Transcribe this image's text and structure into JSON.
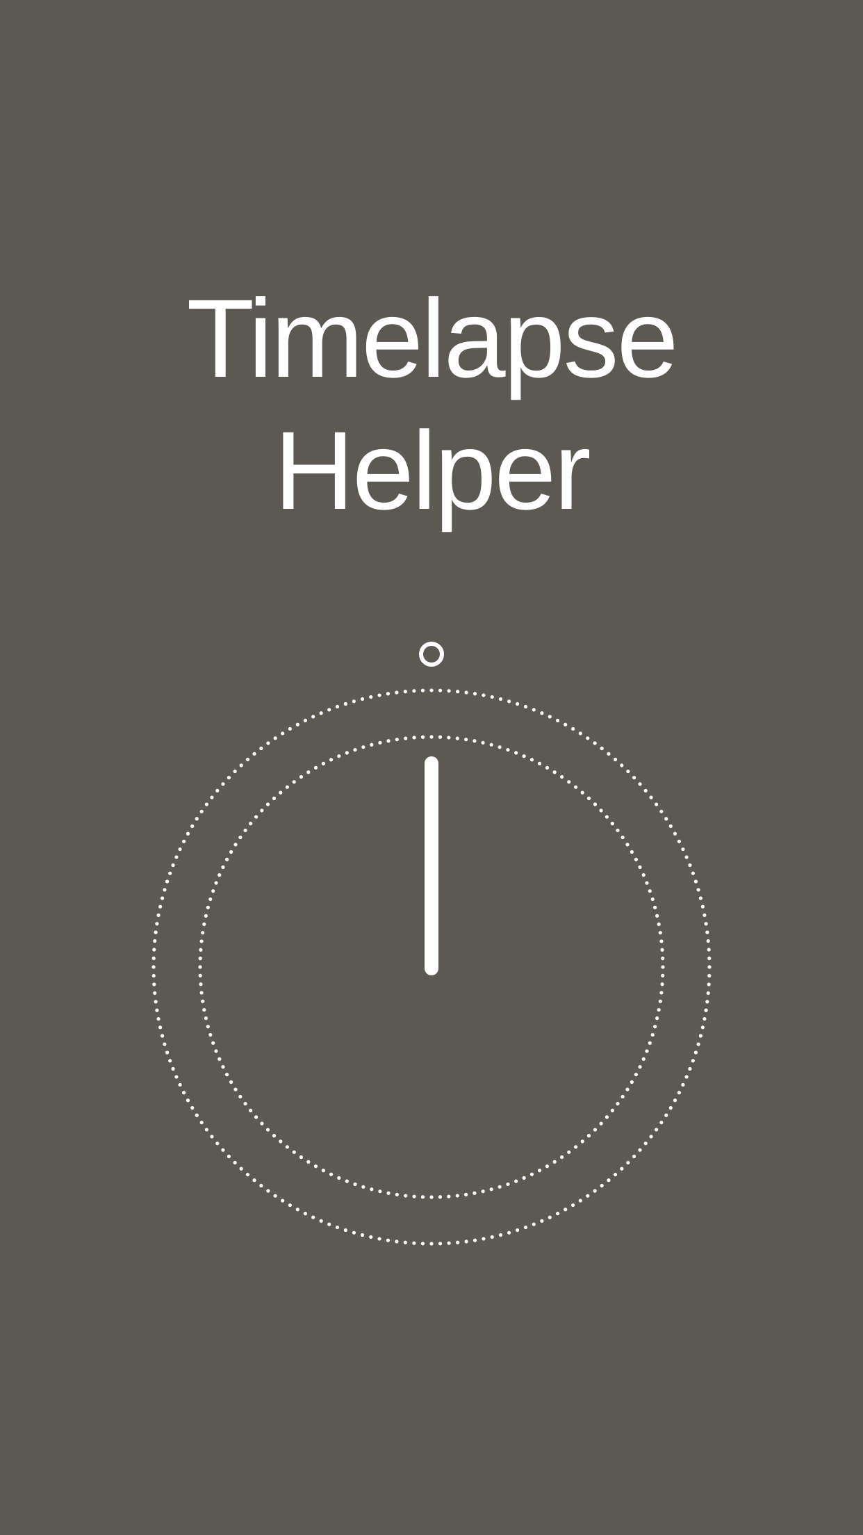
{
  "app": {
    "title_line1": "Timelapse",
    "title_line2": "Helper"
  },
  "dial": {
    "icons": {
      "outer_ring": "dotted-circle",
      "inner_ring": "dotted-circle",
      "hand": "clock-hand",
      "knob": "ring-handle"
    }
  },
  "colors": {
    "background": "#5c5952",
    "foreground": "#ffffff"
  }
}
